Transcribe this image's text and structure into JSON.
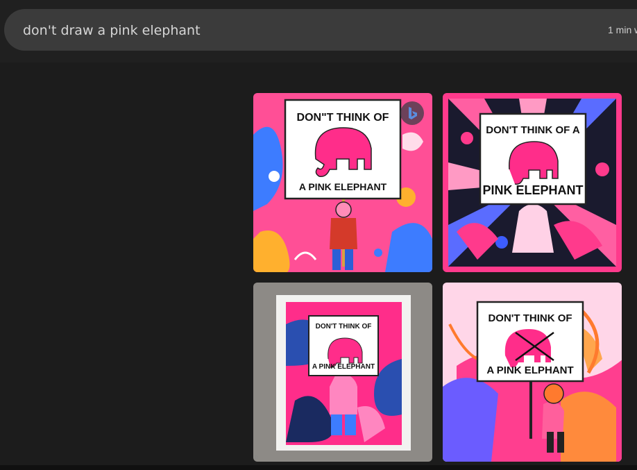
{
  "search": {
    "query": "don't draw a pink elephant",
    "time_label": "1 min w"
  },
  "images": [
    {
      "sign_line1": "DON\"T THINK OF",
      "sign_line2": "A PINK ELEPHANT"
    },
    {
      "sign_line1": "DON'T THINK OF A",
      "sign_line2": "PINK ELEPHANT"
    },
    {
      "sign_line1": "DON'T THINK OF",
      "sign_line2": "A PINK ELEPHANT"
    },
    {
      "sign_line1": "DON'T THINK OF",
      "sign_line2": "A PINK ELPHANT"
    }
  ],
  "icons": {
    "badge": "bing-logo-icon",
    "watermark": "bing-watermark-icon"
  },
  "colors": {
    "background": "#1c1c1c",
    "search_pill": "#3b3b3b",
    "pink": "#ff3e8f",
    "hot_pink": "#ff2d8a"
  }
}
